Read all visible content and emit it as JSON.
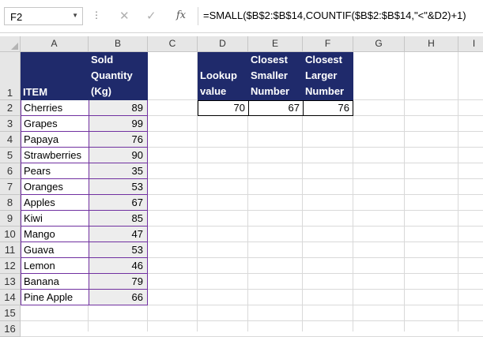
{
  "formula_bar": {
    "name_box": "F2",
    "formula": "=SMALL($B$2:$B$14,COUNTIF($B$2:$B$14,\"<\"&D2)+1)",
    "cancel_icon": "✕",
    "enter_icon": "✓",
    "fx_icon": "fx"
  },
  "columns": [
    "A",
    "B",
    "C",
    "D",
    "E",
    "F",
    "G",
    "H",
    "I"
  ],
  "rows": [
    "1",
    "2",
    "3",
    "4",
    "5",
    "6",
    "7",
    "8",
    "9",
    "10",
    "11",
    "12",
    "13",
    "14",
    "15",
    "16"
  ],
  "table": {
    "header_item": "ITEM",
    "header_qty_lines": [
      "Sold",
      "Quantity",
      "(Kg)"
    ],
    "rows": [
      {
        "item": "Cherries",
        "qty": "89"
      },
      {
        "item": "Grapes",
        "qty": "99"
      },
      {
        "item": "Papaya",
        "qty": "76"
      },
      {
        "item": "Strawberries",
        "qty": "90"
      },
      {
        "item": "Pears",
        "qty": "35"
      },
      {
        "item": "Oranges",
        "qty": "53"
      },
      {
        "item": "Apples",
        "qty": "67"
      },
      {
        "item": "Kiwi",
        "qty": "85"
      },
      {
        "item": "Mango",
        "qty": "47"
      },
      {
        "item": "Guava",
        "qty": "53"
      },
      {
        "item": "Lemon",
        "qty": "46"
      },
      {
        "item": "Banana",
        "qty": "79"
      },
      {
        "item": "Pine Apple",
        "qty": "66"
      }
    ]
  },
  "lookup": {
    "headers": [
      [
        "Lookup",
        "value"
      ],
      [
        "Closest",
        "Smaller",
        "Number"
      ],
      [
        "Closest",
        "Larger",
        "Number"
      ]
    ],
    "values": [
      "70",
      "67",
      "76"
    ]
  },
  "colors": {
    "header_fill": "#1f2a6b",
    "border_accent": "#7030a0",
    "qty_fill": "#ededed"
  }
}
